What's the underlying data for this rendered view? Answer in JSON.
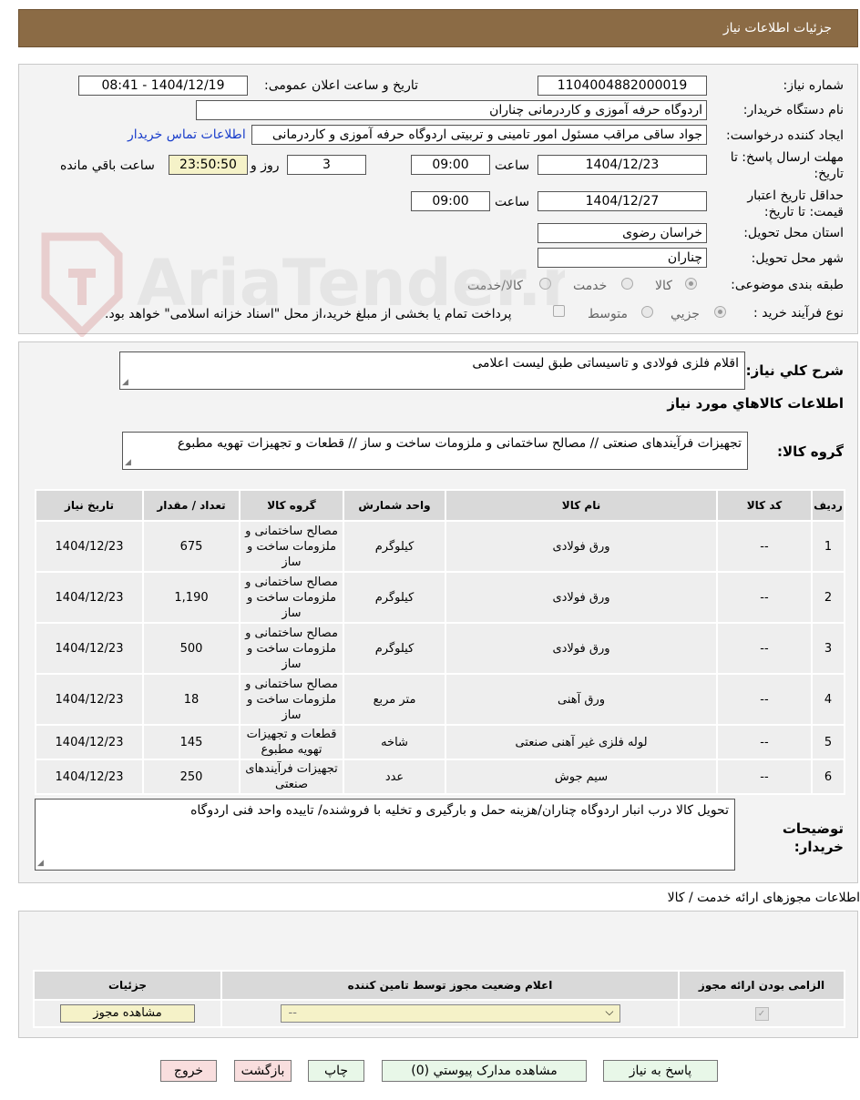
{
  "header": {
    "title": "جزئیات اطلاعات نیاز"
  },
  "info": {
    "need_no_label": "شماره نیاز:",
    "need_no": "1104004882000019",
    "announce_label": "تاریخ و ساعت اعلان عمومی:",
    "announce_value": "1404/12/19 - 08:41",
    "buyer_label": "نام دستگاه خریدار:",
    "buyer_value": "اردوگاه حرفه آموزی و کاردرمانی چناران",
    "creator_label": "ایجاد کننده درخواست:",
    "creator_value": "جواد ساقی مراقب مسئول امور تامینی و تربیتی اردوگاه حرفه آموزی و کاردرمانی",
    "contact_link": "اطلاعات تماس خریدار",
    "deadline_label_1": "مهلت ارسال پاسخ: تا",
    "deadline_label_2": "تاریخ:",
    "deadline_date": "1404/12/23",
    "time_label": "ساعت",
    "deadline_time": "09:00",
    "days_value": "3",
    "days_label": "روز و",
    "remaining_time": "23:50:50",
    "remaining_label": "ساعت باقي مانده",
    "validity_label_1": "حداقل تاریخ اعتبار",
    "validity_label_2": "قیمت: تا تاریخ:",
    "validity_date": "1404/12/27",
    "validity_time": "09:00",
    "province_label": "استان محل تحویل:",
    "province_value": "خراسان رضوی",
    "city_label": "شهر محل تحویل:",
    "city_value": "چناران",
    "category_label": "طبقه بندی موضوعی:",
    "category_options": [
      "کالا",
      "خدمت",
      "کالا/خدمت"
    ],
    "process_label": "نوع فرآیند خرید :",
    "process_options": [
      "جزيي",
      "متوسط"
    ],
    "payment_note": "پرداخت تمام یا بخشی از مبلغ خرید،از محل \"اسناد خزانه اسلامی\" خواهد بود."
  },
  "description": {
    "summary_label": "شرح کلي نياز:",
    "summary_value": "اقلام فلزی فولادی و تاسیساتی طبق لیست اعلامی",
    "goods_info_title": "اطلاعات کالاهاي مورد نياز",
    "group_label": "گروه کالا:",
    "group_value": "تجهیزات فرآیندهای صنعتی // مصالح ساختمانی و ملزومات ساخت و ساز //  قطعات و تجهیزات تهویه مطبوع"
  },
  "items_table": {
    "headers": [
      "رديف",
      "کد کالا",
      "نام کالا",
      "واحد شمارش",
      "گروه کالا",
      "تعداد / مقدار",
      "تاریخ نیاز"
    ],
    "rows": [
      {
        "row": "1",
        "code": "--",
        "name": "ورق فولادی",
        "unit": "کیلوگرم",
        "group": "مصالح ساختمانی و ملزومات ساخت و ساز",
        "qty": "675",
        "date": "1404/12/23"
      },
      {
        "row": "2",
        "code": "--",
        "name": "ورق فولادی",
        "unit": "کیلوگرم",
        "group": "مصالح ساختمانی و ملزومات ساخت و ساز",
        "qty": "1,190",
        "date": "1404/12/23"
      },
      {
        "row": "3",
        "code": "--",
        "name": "ورق فولادی",
        "unit": "کیلوگرم",
        "group": "مصالح ساختمانی و ملزومات ساخت و ساز",
        "qty": "500",
        "date": "1404/12/23"
      },
      {
        "row": "4",
        "code": "--",
        "name": "ورق آهنی",
        "unit": "متر مربع",
        "group": "مصالح ساختمانی و ملزومات ساخت و ساز",
        "qty": "18",
        "date": "1404/12/23"
      },
      {
        "row": "5",
        "code": "--",
        "name": "لوله فلزی غیر آهنی صنعتی",
        "unit": "شاخه",
        "group": "قطعات و تجهیزات تهویه مطبوع",
        "qty": "145",
        "date": "1404/12/23"
      },
      {
        "row": "6",
        "code": "--",
        "name": "سیم جوش",
        "unit": "عدد",
        "group": "تجهیزات فرآیندهای صنعتی",
        "qty": "250",
        "date": "1404/12/23"
      }
    ]
  },
  "buyer_notes": {
    "label_1": "توضیحات",
    "label_2": "خریدار:",
    "value": "تحویل کالا درب انبار اردوگاه چناران/هزینه حمل و بارگیری و تخلیه با فروشنده/ تاییده واحد فنی اردوگاه"
  },
  "license": {
    "section_title": "اطلاعات مجوزهای ارائه خدمت / کالا",
    "headers": [
      "الزامی بودن ارائه مجوز",
      "اعلام وضعیت مجوز توسط تامین کننده",
      "جزئیات"
    ],
    "select_value": "--",
    "view_button": "مشاهده مجوز"
  },
  "footer": {
    "reply": "پاسخ به نیاز",
    "attachments": "مشاهده مدارک پیوستي (0)",
    "print": "چاپ",
    "back": "بازگشت",
    "exit": "خروج"
  },
  "watermark": {
    "text": "AriaTender.net"
  }
}
